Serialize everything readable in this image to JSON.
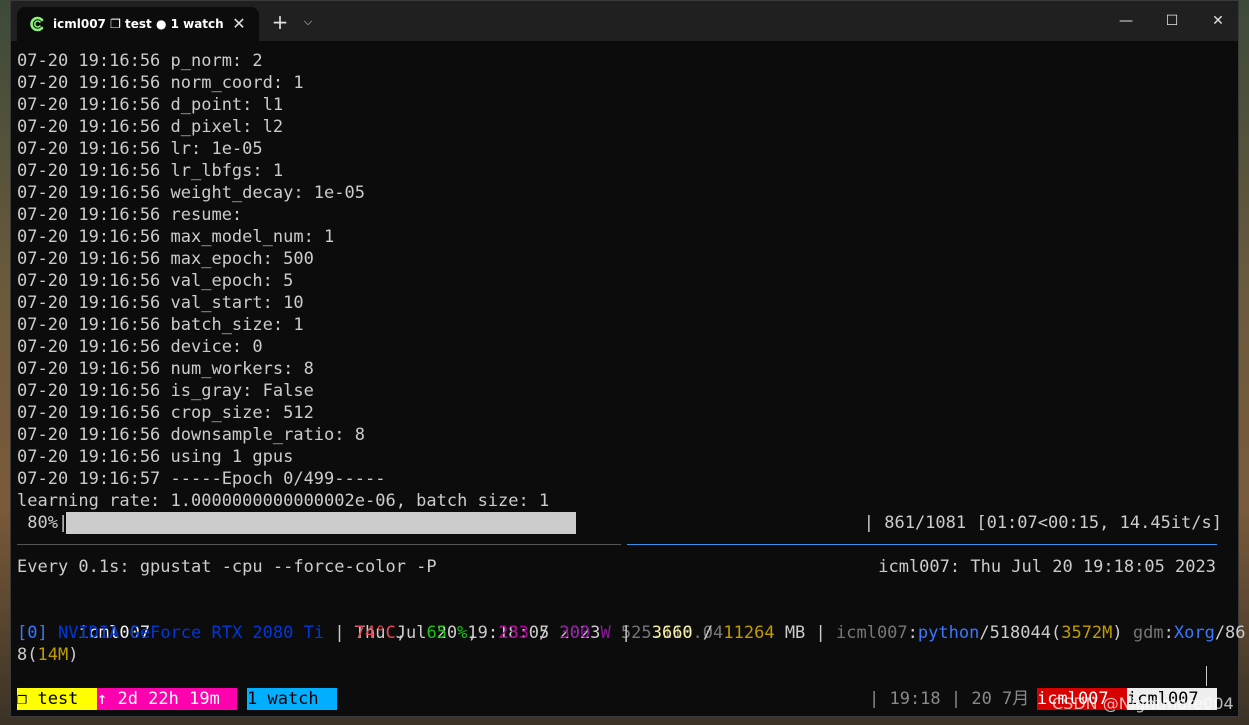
{
  "window": {
    "tab_title": "icml007 ❐ test ● 1 watch",
    "tab_close_icon": "✕",
    "new_tab_icon": "+",
    "dropdown_icon": "⌵",
    "minimize_icon": "—",
    "maximize_icon": "☐",
    "close_icon": "✕"
  },
  "log_lines": [
    "07-20 19:16:56 p_norm: 2",
    "07-20 19:16:56 norm_coord: 1",
    "07-20 19:16:56 d_point: l1",
    "07-20 19:16:56 d_pixel: l2",
    "07-20 19:16:56 lr: 1e-05",
    "07-20 19:16:56 lr_lbfgs: 1",
    "07-20 19:16:56 weight_decay: 1e-05",
    "07-20 19:16:56 resume:",
    "07-20 19:16:56 max_model_num: 1",
    "07-20 19:16:56 max_epoch: 500",
    "07-20 19:16:56 val_epoch: 5",
    "07-20 19:16:56 val_start: 10",
    "07-20 19:16:56 batch_size: 1",
    "07-20 19:16:56 device: 0",
    "07-20 19:16:56 num_workers: 8",
    "07-20 19:16:56 is_gray: False",
    "07-20 19:16:56 crop_size: 512",
    "07-20 19:16:56 downsample_ratio: 8",
    "07-20 19:16:56 using 1 gpus",
    "07-20 19:16:57 -----Epoch 0/499-----",
    "learning rate: 1.0000000000000002e-06, batch size: 1"
  ],
  "progress": {
    "percent_label": " 80%|",
    "fraction": 0.8,
    "info": "| 861/1081 [01:07<00:15, 14.45it/s]"
  },
  "watch": {
    "command": "Every 0.1s: gpustat -cpu --force-color -P",
    "host_time": "icml007: Thu Jul 20 19:18:05 2023"
  },
  "gpustat": {
    "host": "icml007",
    "datetime": "Thu Jul 20 19:18:05 2023",
    "driver": "525.116.04",
    "gpu_index": "[0]",
    "gpu_name": "NVIDIA GeForce RTX 2080 Ti",
    "sep1": " | ",
    "temperature": "74°C",
    "comma1": ",  ",
    "utilization": "65 %",
    "comma2": ",  ",
    "power_draw": "233",
    "slash1": " / ",
    "power_limit": "300 W",
    "sep2": " |  ",
    "mem_used": "3660",
    "slash2": " / ",
    "mem_total": "11264",
    "mem_unit": " MB | ",
    "proc1_user": "icml007",
    "colon1": ":",
    "proc1_cmd": "python",
    "proc1_pid": "/518044(",
    "proc1_mem": "3572M",
    "proc1_close": ") ",
    "proc2_user": "gdm",
    "colon2": ":",
    "proc2_cmd": "Xorg",
    "proc2_pid_a": "/86",
    "proc2_pid_b": "8(",
    "proc2_mem": "14M",
    "proc2_close": ")"
  },
  "tmux": {
    "session": "❐ test",
    "uptime": "↑ 2d 22h 19m",
    "window": "1 watch",
    "time": "| 19:18 | 20 7月 |",
    "host_red": "icml007",
    "host_white": "icml007"
  },
  "colors": {
    "terminal_bg": "#0c0c0c",
    "text": "#cccccc",
    "white": "#f2f2f2",
    "blue": "#0037da",
    "light_blue": "#3b78ff",
    "red": "#e74856",
    "green": "#16c60c",
    "magenta": "#881798",
    "light_yellow": "#f9f1a5",
    "yellow": "#c19c00",
    "gray": "#767676",
    "tmux_yellow": "#ffff00",
    "tmux_magenta": "#ff00af",
    "tmux_cyan": "#00afff",
    "tmux_red": "#d70000"
  },
  "watermark": "CSDN @Nightmare004"
}
